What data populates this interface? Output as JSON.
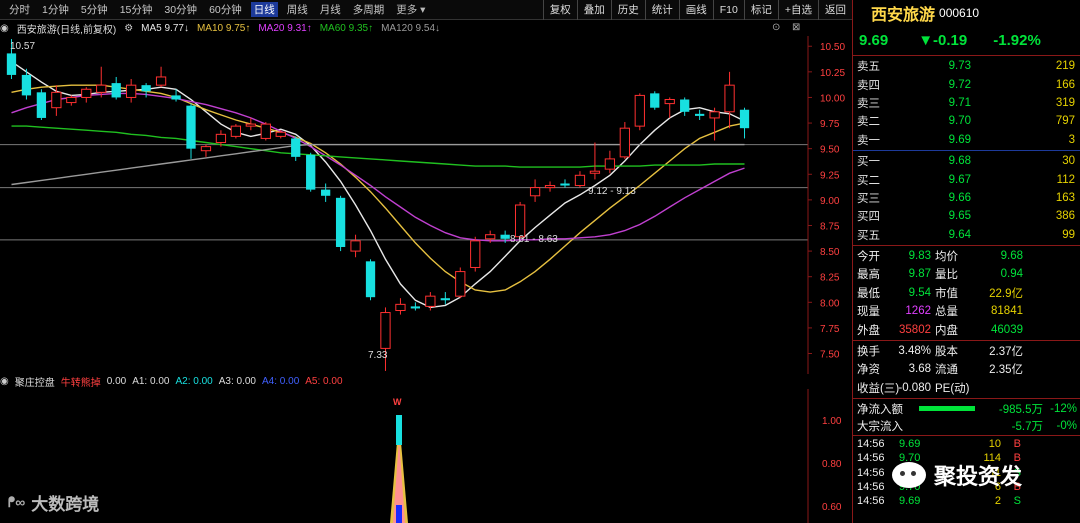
{
  "toolbar": {
    "periods": [
      "分时",
      "1分钟",
      "5分钟",
      "15分钟",
      "30分钟",
      "60分钟",
      "日线",
      "周线",
      "月线",
      "多周期",
      "更多"
    ],
    "active_period": "日线",
    "buttons": [
      "复权",
      "叠加",
      "历史",
      "统计",
      "画线",
      "F10",
      "标记",
      "+自选",
      "返回"
    ]
  },
  "ma_line": {
    "title": "西安旅游(日线,前复权)",
    "ma5": "MA5 9.77↓",
    "ma10": "MA10 9.75↑",
    "ma20": "MA20 9.31↑",
    "ma60": "MA60 9.35↑",
    "ma120": "MA120 9.54↓"
  },
  "indicator_line": {
    "name": "聚庄控盘",
    "label": "牛转熊掉",
    "v0": "0.00",
    "a1": "A1: 0.00",
    "a2": "A2: 0.00",
    "a3": "A3: 0.00",
    "a4": "A4: 0.00",
    "a5": "A5: 0.00"
  },
  "chart_annotations": {
    "high_label": "10.57",
    "low_label": "7.33",
    "mid_label_1": "8.61 - 8.63",
    "mid_label_2": "9.12 - 9.13",
    "indicator_marker": "W"
  },
  "chart_data": {
    "type": "candlestick",
    "ylim": [
      7.3,
      10.6
    ],
    "y_ticks": [
      "10.50",
      "10.25",
      "10.00",
      "9.75",
      "9.50",
      "9.25",
      "9.00",
      "8.75",
      "8.50",
      "8.25",
      "8.00",
      "7.75",
      "7.50"
    ],
    "indicator_ticks": [
      "1.00",
      "0.80",
      "0.60"
    ],
    "candles": [
      {
        "o": 10.43,
        "h": 10.57,
        "l": 10.18,
        "c": 10.22
      },
      {
        "o": 10.22,
        "h": 10.28,
        "l": 9.98,
        "c": 10.02
      },
      {
        "o": 10.05,
        "h": 10.08,
        "l": 9.78,
        "c": 9.8
      },
      {
        "o": 9.9,
        "h": 10.12,
        "l": 9.82,
        "c": 10.05
      },
      {
        "o": 9.95,
        "h": 10.02,
        "l": 9.92,
        "c": 10.0
      },
      {
        "o": 10.0,
        "h": 10.1,
        "l": 9.95,
        "c": 10.08
      },
      {
        "o": 10.05,
        "h": 10.3,
        "l": 10.0,
        "c": 10.12
      },
      {
        "o": 10.14,
        "h": 10.2,
        "l": 9.98,
        "c": 10.0
      },
      {
        "o": 10.0,
        "h": 10.18,
        "l": 9.95,
        "c": 10.12
      },
      {
        "o": 10.12,
        "h": 10.14,
        "l": 10.0,
        "c": 10.06
      },
      {
        "o": 10.12,
        "h": 10.3,
        "l": 10.1,
        "c": 10.2
      },
      {
        "o": 10.02,
        "h": 10.08,
        "l": 9.96,
        "c": 9.98
      },
      {
        "o": 9.92,
        "h": 9.94,
        "l": 9.4,
        "c": 9.5
      },
      {
        "o": 9.48,
        "h": 9.54,
        "l": 9.42,
        "c": 9.52
      },
      {
        "o": 9.56,
        "h": 9.68,
        "l": 9.52,
        "c": 9.64
      },
      {
        "o": 9.62,
        "h": 9.74,
        "l": 9.6,
        "c": 9.72
      },
      {
        "o": 9.72,
        "h": 9.8,
        "l": 9.68,
        "c": 9.74
      },
      {
        "o": 9.6,
        "h": 9.76,
        "l": 9.58,
        "c": 9.74
      },
      {
        "o": 9.62,
        "h": 9.68,
        "l": 9.6,
        "c": 9.66
      },
      {
        "o": 9.6,
        "h": 9.62,
        "l": 9.38,
        "c": 9.42
      },
      {
        "o": 9.44,
        "h": 9.46,
        "l": 9.08,
        "c": 9.1
      },
      {
        "o": 9.1,
        "h": 9.16,
        "l": 8.98,
        "c": 9.04
      },
      {
        "o": 9.02,
        "h": 9.04,
        "l": 8.5,
        "c": 8.54
      },
      {
        "o": 8.5,
        "h": 8.66,
        "l": 8.44,
        "c": 8.6
      },
      {
        "o": 8.4,
        "h": 8.42,
        "l": 8.02,
        "c": 8.05
      },
      {
        "o": 7.55,
        "h": 7.95,
        "l": 7.33,
        "c": 7.9
      },
      {
        "o": 7.92,
        "h": 8.04,
        "l": 7.88,
        "c": 7.98
      },
      {
        "o": 7.96,
        "h": 8.0,
        "l": 7.92,
        "c": 7.94
      },
      {
        "o": 7.96,
        "h": 8.1,
        "l": 7.92,
        "c": 8.06
      },
      {
        "o": 8.04,
        "h": 8.1,
        "l": 7.98,
        "c": 8.02
      },
      {
        "o": 8.06,
        "h": 8.34,
        "l": 8.04,
        "c": 8.3
      },
      {
        "o": 8.34,
        "h": 8.64,
        "l": 8.3,
        "c": 8.6
      },
      {
        "o": 8.62,
        "h": 8.7,
        "l": 8.58,
        "c": 8.66
      },
      {
        "o": 8.66,
        "h": 8.7,
        "l": 8.58,
        "c": 8.62
      },
      {
        "o": 8.64,
        "h": 8.98,
        "l": 8.62,
        "c": 8.95
      },
      {
        "o": 9.04,
        "h": 9.2,
        "l": 8.98,
        "c": 9.12
      },
      {
        "o": 9.12,
        "h": 9.18,
        "l": 9.08,
        "c": 9.14
      },
      {
        "o": 9.16,
        "h": 9.2,
        "l": 9.12,
        "c": 9.14
      },
      {
        "o": 9.14,
        "h": 9.28,
        "l": 9.12,
        "c": 9.24
      },
      {
        "o": 9.26,
        "h": 9.56,
        "l": 9.2,
        "c": 9.28
      },
      {
        "o": 9.3,
        "h": 9.48,
        "l": 9.26,
        "c": 9.4
      },
      {
        "o": 9.42,
        "h": 9.76,
        "l": 9.4,
        "c": 9.7
      },
      {
        "o": 9.72,
        "h": 10.04,
        "l": 9.68,
        "c": 10.02
      },
      {
        "o": 10.04,
        "h": 10.06,
        "l": 9.88,
        "c": 9.9
      },
      {
        "o": 9.94,
        "h": 10.0,
        "l": 9.8,
        "c": 9.98
      },
      {
        "o": 9.98,
        "h": 10.0,
        "l": 9.82,
        "c": 9.86
      },
      {
        "o": 9.84,
        "h": 9.88,
        "l": 9.78,
        "c": 9.82
      },
      {
        "o": 9.8,
        "h": 9.9,
        "l": 9.58,
        "c": 9.86
      },
      {
        "o": 9.86,
        "h": 10.25,
        "l": 9.7,
        "c": 10.12
      },
      {
        "o": 9.88,
        "h": 9.9,
        "l": 9.6,
        "c": 9.7
      }
    ],
    "ma_series": [
      {
        "name": "MA5",
        "color": "#e8e8e8",
        "values": [
          10.35,
          10.25,
          10.15,
          10.06,
          10.02,
          10.03,
          10.05,
          10.06,
          10.07,
          10.08,
          10.1,
          10.08,
          9.98,
          9.86,
          9.74,
          9.66,
          9.62,
          9.65,
          9.69,
          9.64,
          9.53,
          9.37,
          9.18,
          8.95,
          8.7,
          8.42,
          8.18,
          8.02,
          7.95,
          7.97,
          8.05,
          8.18,
          8.3,
          8.45,
          8.6,
          8.73,
          8.85,
          8.97,
          9.05,
          9.14,
          9.24,
          9.38,
          9.54,
          9.68,
          9.8,
          9.88,
          9.9,
          9.86,
          9.84,
          9.77
        ]
      },
      {
        "name": "MA10",
        "color": "#e6c040",
        "values": [
          10.05,
          10.08,
          10.1,
          10.11,
          10.12,
          10.12,
          10.12,
          10.1,
          10.08,
          10.06,
          10.04,
          10.0,
          9.94,
          9.88,
          9.83,
          9.78,
          9.74,
          9.7,
          9.66,
          9.61,
          9.55,
          9.46,
          9.35,
          9.22,
          9.08,
          8.92,
          8.75,
          8.58,
          8.43,
          8.3,
          8.2,
          8.12,
          8.1,
          8.12,
          8.2,
          8.3,
          8.42,
          8.55,
          8.68,
          8.8,
          8.92,
          9.03,
          9.14,
          9.26,
          9.38,
          9.5,
          9.6,
          9.66,
          9.72,
          9.75
        ]
      },
      {
        "name": "MA20",
        "color": "#c040d0",
        "values": [
          9.85,
          9.9,
          9.94,
          9.98,
          10.0,
          10.02,
          10.03,
          10.04,
          10.04,
          10.03,
          10.01,
          9.99,
          9.96,
          9.93,
          9.89,
          9.85,
          9.8,
          9.74,
          9.67,
          9.6,
          9.52,
          9.43,
          9.34,
          9.24,
          9.14,
          9.03,
          8.93,
          8.83,
          8.75,
          8.68,
          8.63,
          8.61,
          8.6,
          8.6,
          8.61,
          8.61,
          8.62,
          8.62,
          8.63,
          8.64,
          8.66,
          8.7,
          8.76,
          8.84,
          8.93,
          9.02,
          9.1,
          9.18,
          9.26,
          9.31
        ]
      },
      {
        "name": "MA60",
        "color": "#20c020",
        "values": [
          9.72,
          9.72,
          9.71,
          9.7,
          9.69,
          9.68,
          9.67,
          9.66,
          9.64,
          9.63,
          9.61,
          9.6,
          9.58,
          9.56,
          9.54,
          9.52,
          9.5,
          9.48,
          9.46,
          9.45,
          9.44,
          9.43,
          9.42,
          9.41,
          9.4,
          9.39,
          9.38,
          9.37,
          9.36,
          9.35,
          9.34,
          9.33,
          9.33,
          9.33,
          9.32,
          9.32,
          9.32,
          9.32,
          9.32,
          9.33,
          9.33,
          9.33,
          9.33,
          9.34,
          9.34,
          9.34,
          9.34,
          9.35,
          9.35,
          9.35
        ]
      },
      {
        "name": "MA120",
        "color": "#9a9a9a",
        "values": [
          9.15,
          9.17,
          9.19,
          9.21,
          9.23,
          9.25,
          9.27,
          9.29,
          9.31,
          9.33,
          9.35,
          9.37,
          9.39,
          9.41,
          9.43,
          9.45,
          9.47,
          9.49,
          9.51,
          9.53,
          9.54,
          9.54,
          9.54,
          9.54,
          9.54,
          9.54,
          9.54,
          9.54,
          9.54,
          9.54,
          9.54,
          9.54,
          9.54,
          9.54,
          9.54,
          9.54,
          9.54,
          9.54,
          9.54,
          9.54,
          9.54,
          9.54,
          9.54,
          9.54,
          9.54,
          9.54,
          9.54,
          9.54,
          9.54,
          9.54
        ]
      }
    ],
    "horizontal_levels": [
      9.54,
      9.12,
      8.61
    ]
  },
  "quote": {
    "name": "西安旅游",
    "code": "000610",
    "price": "9.69",
    "change": "▼-0.19",
    "pct": "-1.92%",
    "asks": [
      {
        "label": "卖五",
        "price": "9.73",
        "vol": "219"
      },
      {
        "label": "卖四",
        "price": "9.72",
        "vol": "166"
      },
      {
        "label": "卖三",
        "price": "9.71",
        "vol": "319"
      },
      {
        "label": "卖二",
        "price": "9.70",
        "vol": "797"
      },
      {
        "label": "卖一",
        "price": "9.69",
        "vol": "3"
      }
    ],
    "bids": [
      {
        "label": "买一",
        "price": "9.68",
        "vol": "30"
      },
      {
        "label": "买二",
        "price": "9.67",
        "vol": "112"
      },
      {
        "label": "买三",
        "price": "9.66",
        "vol": "163"
      },
      {
        "label": "买四",
        "price": "9.65",
        "vol": "386"
      },
      {
        "label": "买五",
        "price": "9.64",
        "vol": "99"
      }
    ],
    "stats": [
      {
        "l1": "今开",
        "v1": "9.83",
        "l2": "均价",
        "v2": "9.68"
      },
      {
        "l1": "最高",
        "v1": "9.87",
        "l2": "量比",
        "v2": "0.94"
      },
      {
        "l1": "最低",
        "v1": "9.54",
        "l2": "市值",
        "v2": "22.9亿"
      },
      {
        "l1": "现量",
        "v1": "1262",
        "l2": "总量",
        "v2": "81841"
      },
      {
        "l1": "外盘",
        "v1": "35802",
        "l2": "内盘",
        "v2": "46039"
      }
    ],
    "stats2": [
      {
        "l1": "换手",
        "v1": "3.48%",
        "l2": "股本",
        "v2": "2.37亿"
      },
      {
        "l1": "净资",
        "v1": "3.68",
        "l2": "流通",
        "v2": "2.35亿"
      },
      {
        "l1": "收益(三)",
        "v1": "-0.080",
        "l2": "PE(动)",
        "v2": ""
      }
    ],
    "flow": [
      {
        "label": "净流入额",
        "value": "-985.5万",
        "pct": "-12%"
      },
      {
        "label": "大宗流入",
        "value": "-5.7万",
        "pct": "-0%"
      }
    ],
    "ticks": [
      {
        "time": "14:56",
        "price": "9.69",
        "vol": "10",
        "flag": "B"
      },
      {
        "time": "14:56",
        "price": "9.70",
        "vol": "114",
        "flag": "B"
      },
      {
        "time": "14:56",
        "price": "9.69",
        "vol": "11",
        "flag": "S"
      },
      {
        "time": "14:56",
        "price": "9.70",
        "vol": "6",
        "flag": "B"
      },
      {
        "time": "14:56",
        "price": "9.69",
        "vol": "2",
        "flag": "S"
      }
    ]
  },
  "watermarks": {
    "left": "大数跨境",
    "right": "聚投资发"
  }
}
